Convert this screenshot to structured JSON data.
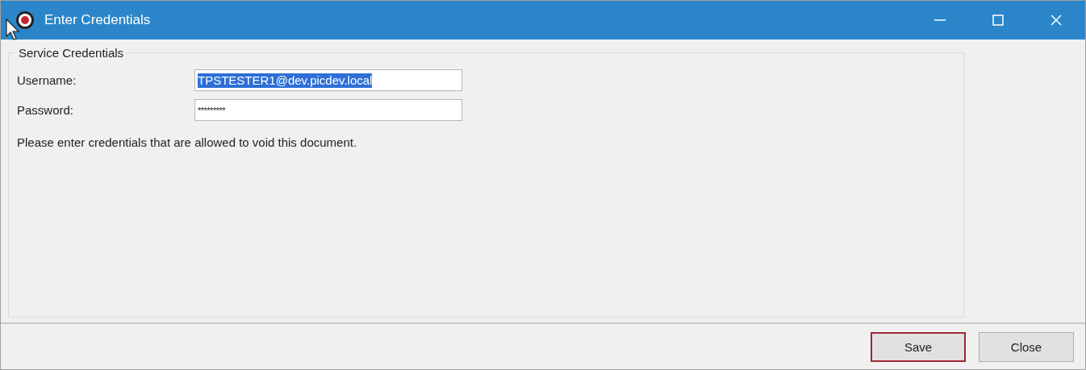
{
  "window": {
    "title": "Enter Credentials"
  },
  "group": {
    "title": "Service Credentials",
    "fields": [
      {
        "label": "Username:",
        "value": "TPSTESTER1@dev.picdev.local",
        "kind": "text",
        "selected": true
      },
      {
        "label": "Password:",
        "value": "*********",
        "kind": "password",
        "selected": false
      }
    ],
    "message": "Please enter credentials that are allowed to void this document."
  },
  "buttons": [
    {
      "label": "Save",
      "default": true
    },
    {
      "label": "Close",
      "default": false
    }
  ]
}
